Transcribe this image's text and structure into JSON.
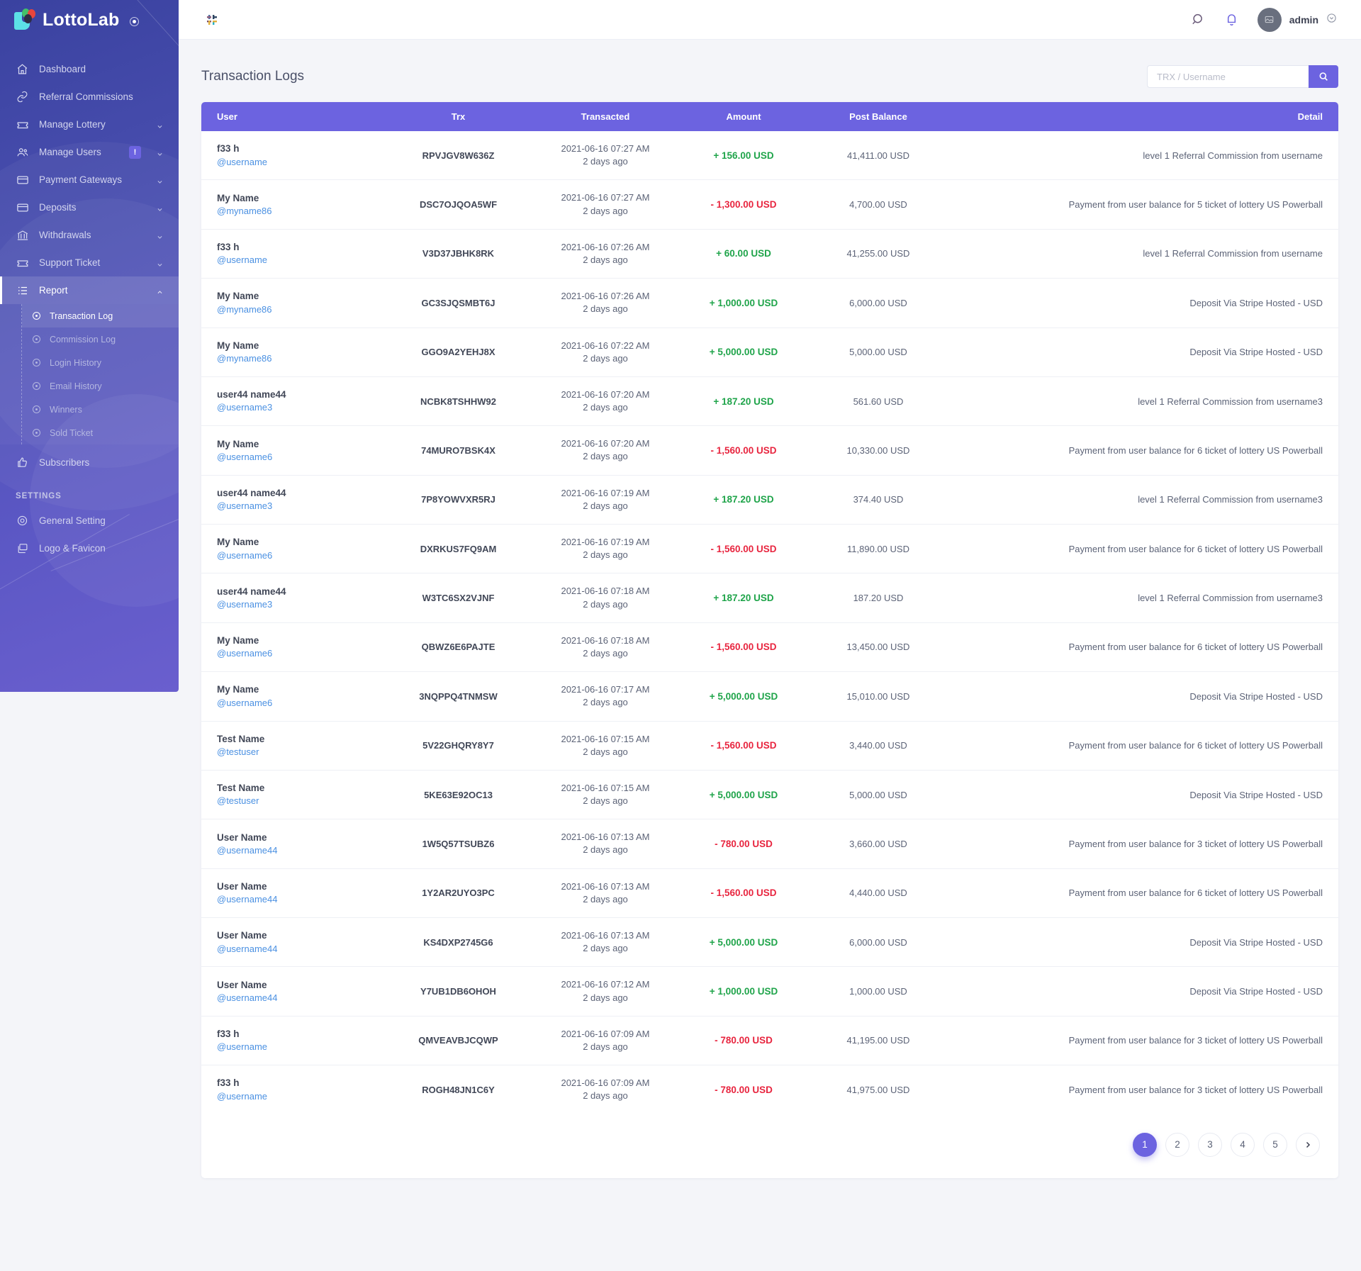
{
  "brand": {
    "name": "LottoLab"
  },
  "topbar": {
    "collapse_label": "collapse-sidebar",
    "search_icon": "search-icon",
    "bell_icon": "bell-icon",
    "user_name": "admin"
  },
  "sidebar": {
    "items": [
      {
        "label": "Dashboard",
        "icon": "home-icon",
        "caret": false,
        "badge": null
      },
      {
        "label": "Referral Commissions",
        "icon": "link-icon",
        "caret": false,
        "badge": null
      },
      {
        "label": "Manage Lottery",
        "icon": "ticket-icon",
        "caret": true,
        "badge": null
      },
      {
        "label": "Manage Users",
        "icon": "users-icon",
        "caret": true,
        "badge": "!"
      },
      {
        "label": "Payment Gateways",
        "icon": "card-icon",
        "caret": true,
        "badge": null
      },
      {
        "label": "Deposits",
        "icon": "card-icon",
        "caret": true,
        "badge": null
      },
      {
        "label": "Withdrawals",
        "icon": "bank-icon",
        "caret": true,
        "badge": null
      },
      {
        "label": "Support Ticket",
        "icon": "ticket-icon",
        "caret": true,
        "badge": null
      },
      {
        "label": "Report",
        "icon": "list-icon",
        "caret": true,
        "badge": null,
        "active": true
      }
    ],
    "report_submenu": [
      {
        "label": "Transaction Log",
        "active": true
      },
      {
        "label": "Commission Log",
        "active": false
      },
      {
        "label": "Login History",
        "active": false
      },
      {
        "label": "Email History",
        "active": false
      },
      {
        "label": "Winners",
        "active": false
      },
      {
        "label": "Sold Ticket",
        "active": false
      }
    ],
    "subscribers": {
      "label": "Subscribers",
      "icon": "thumbs-up-icon"
    },
    "settings_heading": "SETTINGS",
    "settings_items": [
      {
        "label": "General Setting",
        "icon": "gear-icon"
      },
      {
        "label": "Logo & Favicon",
        "icon": "images-icon"
      }
    ]
  },
  "page": {
    "title": "Transaction Logs",
    "search": {
      "placeholder": "TRX / Username",
      "value": "",
      "button_icon": "search-icon"
    }
  },
  "table": {
    "columns": [
      "User",
      "Trx",
      "Transacted",
      "Amount",
      "Post Balance",
      "Detail"
    ],
    "rows": [
      {
        "name": "f33 h",
        "handle": "@username",
        "trx": "RPVJGV8W636Z",
        "date": "2021-06-16 07:27 AM",
        "ago": "2 days ago",
        "amount": "+ 156.00 USD",
        "sign": "pos",
        "post_balance": "41,411.00 USD",
        "detail": "level 1 Referral Commission from username"
      },
      {
        "name": "My Name",
        "handle": "@myname86",
        "trx": "DSC7OJQOA5WF",
        "date": "2021-06-16 07:27 AM",
        "ago": "2 days ago",
        "amount": "- 1,300.00 USD",
        "sign": "neg",
        "post_balance": "4,700.00 USD",
        "detail": "Payment from user balance for 5 ticket of lottery US Powerball"
      },
      {
        "name": "f33 h",
        "handle": "@username",
        "trx": "V3D37JBHK8RK",
        "date": "2021-06-16 07:26 AM",
        "ago": "2 days ago",
        "amount": "+ 60.00 USD",
        "sign": "pos",
        "post_balance": "41,255.00 USD",
        "detail": "level 1 Referral Commission from username"
      },
      {
        "name": "My Name",
        "handle": "@myname86",
        "trx": "GC3SJQSMBT6J",
        "date": "2021-06-16 07:26 AM",
        "ago": "2 days ago",
        "amount": "+ 1,000.00 USD",
        "sign": "pos",
        "post_balance": "6,000.00 USD",
        "detail": "Deposit Via Stripe Hosted - USD"
      },
      {
        "name": "My Name",
        "handle": "@myname86",
        "trx": "GGO9A2YEHJ8X",
        "date": "2021-06-16 07:22 AM",
        "ago": "2 days ago",
        "amount": "+ 5,000.00 USD",
        "sign": "pos",
        "post_balance": "5,000.00 USD",
        "detail": "Deposit Via Stripe Hosted - USD"
      },
      {
        "name": "user44 name44",
        "handle": "@username3",
        "trx": "NCBK8TSHHW92",
        "date": "2021-06-16 07:20 AM",
        "ago": "2 days ago",
        "amount": "+ 187.20 USD",
        "sign": "pos",
        "post_balance": "561.60 USD",
        "detail": "level 1 Referral Commission from username3"
      },
      {
        "name": "My Name",
        "handle": "@username6",
        "trx": "74MURO7BSK4X",
        "date": "2021-06-16 07:20 AM",
        "ago": "2 days ago",
        "amount": "- 1,560.00 USD",
        "sign": "neg",
        "post_balance": "10,330.00 USD",
        "detail": "Payment from user balance for 6 ticket of lottery US Powerball"
      },
      {
        "name": "user44 name44",
        "handle": "@username3",
        "trx": "7P8YOWVXR5RJ",
        "date": "2021-06-16 07:19 AM",
        "ago": "2 days ago",
        "amount": "+ 187.20 USD",
        "sign": "pos",
        "post_balance": "374.40 USD",
        "detail": "level 1 Referral Commission from username3"
      },
      {
        "name": "My Name",
        "handle": "@username6",
        "trx": "DXRKUS7FQ9AM",
        "date": "2021-06-16 07:19 AM",
        "ago": "2 days ago",
        "amount": "- 1,560.00 USD",
        "sign": "neg",
        "post_balance": "11,890.00 USD",
        "detail": "Payment from user balance for 6 ticket of lottery US Powerball"
      },
      {
        "name": "user44 name44",
        "handle": "@username3",
        "trx": "W3TC6SX2VJNF",
        "date": "2021-06-16 07:18 AM",
        "ago": "2 days ago",
        "amount": "+ 187.20 USD",
        "sign": "pos",
        "post_balance": "187.20 USD",
        "detail": "level 1 Referral Commission from username3"
      },
      {
        "name": "My Name",
        "handle": "@username6",
        "trx": "QBWZ6E6PAJTE",
        "date": "2021-06-16 07:18 AM",
        "ago": "2 days ago",
        "amount": "- 1,560.00 USD",
        "sign": "neg",
        "post_balance": "13,450.00 USD",
        "detail": "Payment from user balance for 6 ticket of lottery US Powerball"
      },
      {
        "name": "My Name",
        "handle": "@username6",
        "trx": "3NQPPQ4TNMSW",
        "date": "2021-06-16 07:17 AM",
        "ago": "2 days ago",
        "amount": "+ 5,000.00 USD",
        "sign": "pos",
        "post_balance": "15,010.00 USD",
        "detail": "Deposit Via Stripe Hosted - USD"
      },
      {
        "name": "Test Name",
        "handle": "@testuser",
        "trx": "5V22GHQRY8Y7",
        "date": "2021-06-16 07:15 AM",
        "ago": "2 days ago",
        "amount": "- 1,560.00 USD",
        "sign": "neg",
        "post_balance": "3,440.00 USD",
        "detail": "Payment from user balance for 6 ticket of lottery US Powerball"
      },
      {
        "name": "Test Name",
        "handle": "@testuser",
        "trx": "5KE63E92OC13",
        "date": "2021-06-16 07:15 AM",
        "ago": "2 days ago",
        "amount": "+ 5,000.00 USD",
        "sign": "pos",
        "post_balance": "5,000.00 USD",
        "detail": "Deposit Via Stripe Hosted - USD"
      },
      {
        "name": "User Name",
        "handle": "@username44",
        "trx": "1W5Q57TSUBZ6",
        "date": "2021-06-16 07:13 AM",
        "ago": "2 days ago",
        "amount": "- 780.00 USD",
        "sign": "neg",
        "post_balance": "3,660.00 USD",
        "detail": "Payment from user balance for 3 ticket of lottery US Powerball"
      },
      {
        "name": "User Name",
        "handle": "@username44",
        "trx": "1Y2AR2UYO3PC",
        "date": "2021-06-16 07:13 AM",
        "ago": "2 days ago",
        "amount": "- 1,560.00 USD",
        "sign": "neg",
        "post_balance": "4,440.00 USD",
        "detail": "Payment from user balance for 6 ticket of lottery US Powerball"
      },
      {
        "name": "User Name",
        "handle": "@username44",
        "trx": "KS4DXP2745G6",
        "date": "2021-06-16 07:13 AM",
        "ago": "2 days ago",
        "amount": "+ 5,000.00 USD",
        "sign": "pos",
        "post_balance": "6,000.00 USD",
        "detail": "Deposit Via Stripe Hosted - USD"
      },
      {
        "name": "User Name",
        "handle": "@username44",
        "trx": "Y7UB1DB6OHOH",
        "date": "2021-06-16 07:12 AM",
        "ago": "2 days ago",
        "amount": "+ 1,000.00 USD",
        "sign": "pos",
        "post_balance": "1,000.00 USD",
        "detail": "Deposit Via Stripe Hosted - USD"
      },
      {
        "name": "f33 h",
        "handle": "@username",
        "trx": "QMVEAVBJCQWP",
        "date": "2021-06-16 07:09 AM",
        "ago": "2 days ago",
        "amount": "- 780.00 USD",
        "sign": "neg",
        "post_balance": "41,195.00 USD",
        "detail": "Payment from user balance for 3 ticket of lottery US Powerball"
      },
      {
        "name": "f33 h",
        "handle": "@username",
        "trx": "ROGH48JN1C6Y",
        "date": "2021-06-16 07:09 AM",
        "ago": "2 days ago",
        "amount": "- 780.00 USD",
        "sign": "neg",
        "post_balance": "41,975.00 USD",
        "detail": "Payment from user balance for 3 ticket of lottery US Powerball"
      }
    ]
  },
  "pagination": {
    "pages": [
      "1",
      "2",
      "3",
      "4",
      "5"
    ],
    "current": "1",
    "next_icon": "chevron-right-icon"
  },
  "colors": {
    "accent": "#6c63e0",
    "positive": "#1fa44a",
    "negative": "#e8253f",
    "link": "#4a90e2"
  }
}
